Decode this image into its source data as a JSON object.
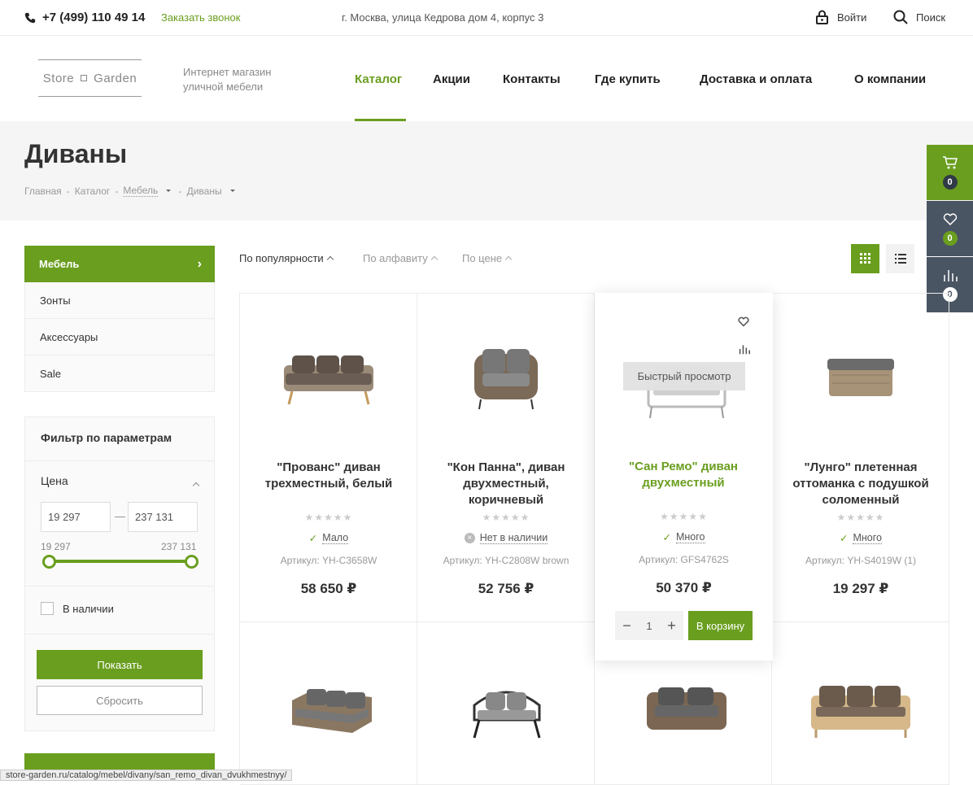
{
  "topbar": {
    "phone": "+7 (499) 110 49 14",
    "callback": "Заказать звонок",
    "address": "г. Москва, улица Кедрова дом 4, корпус 3",
    "login": "Войти",
    "search": "Поиск"
  },
  "header": {
    "logo_left": "Store",
    "logo_right": "Garden",
    "tagline": "Интернет магазин уличной мебели",
    "nav": [
      "Каталог",
      "Акции",
      "Контакты",
      "Где купить",
      "Доставка и оплата",
      "О компании"
    ]
  },
  "page": {
    "title": "Диваны",
    "breadcrumbs": [
      "Главная",
      "Каталог",
      "Мебель",
      "Диваны"
    ]
  },
  "side_panel": {
    "cart_count": "0",
    "fav_count": "0",
    "compare_count": "0"
  },
  "menu": [
    "Мебель",
    "Зонты",
    "Аксессуары",
    "Sale"
  ],
  "filter": {
    "title": "Фильтр по параметрам",
    "price_label": "Цена",
    "min_placeholder": "19 297",
    "max_placeholder": "237 131",
    "min_label": "19 297",
    "max_label": "237 131",
    "in_stock": "В наличии",
    "show": "Показать",
    "reset": "Сбросить"
  },
  "sort": [
    "По популярности",
    "По алфавиту",
    "По цене"
  ],
  "products": [
    {
      "name": "\"Прованс\" диван трехместный, белый",
      "stock": "Мало",
      "sku": "Артикул: YH-C3658W",
      "price": "58 650 ₽",
      "in_stock": true
    },
    {
      "name": "\"Кон Панна\", диван двухместный, коричневый",
      "stock": "Нет в наличии",
      "sku": "Артикул: YH-C2808W brown",
      "price": "52 756 ₽",
      "in_stock": false
    },
    {
      "name": "\"Сан Ремо\" диван двухместный",
      "stock": "Много",
      "sku": "Артикул: GFS4762S",
      "price": "50 370 ₽",
      "in_stock": true
    },
    {
      "name": "\"Лунго\" плетенная оттоманка с подушкой соломенный",
      "stock": "Много",
      "sku": "Артикул: YH-S4019W (1)",
      "price": "19 297 ₽",
      "in_stock": true
    }
  ],
  "hover": {
    "quick_view": "Быстрый просмотр",
    "qty": "1",
    "to_cart": "В корзину"
  },
  "status_url": "store-garden.ru/catalog/mebel/divany/san_remo_divan_dvukhmestnyy/",
  "colors": {
    "accent": "#6a9e1f",
    "panel_dark": "#4a5563"
  }
}
